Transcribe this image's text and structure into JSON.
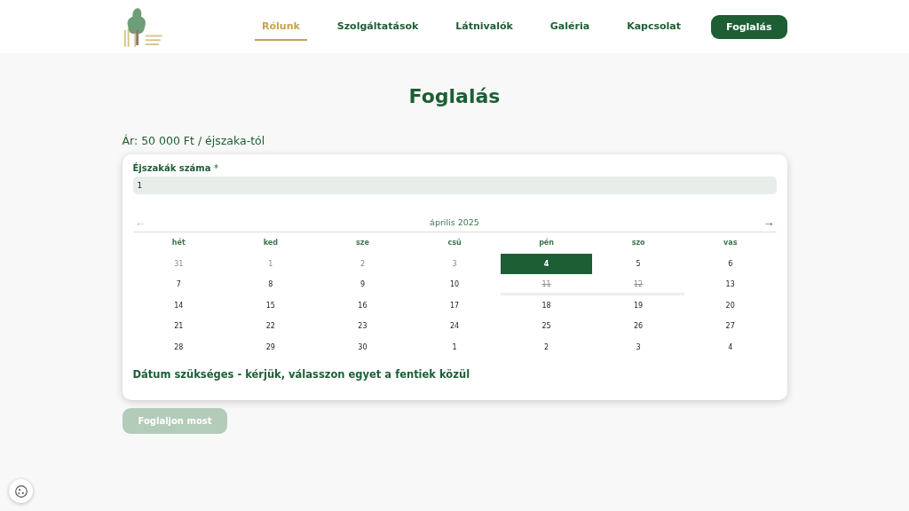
{
  "nav": {
    "items": [
      {
        "label": "Rólunk",
        "selected": true
      },
      {
        "label": "Szolgáltatások",
        "selected": false
      },
      {
        "label": "Látnivalók",
        "selected": false
      },
      {
        "label": "Galéria",
        "selected": false
      },
      {
        "label": "Kapcsolat",
        "selected": false
      }
    ],
    "cta": "Foglalás"
  },
  "heading": "Foglalás",
  "price": "Ár: 50 000 Ft / éjszaka-tól",
  "form": {
    "nights_label": "Éjszakák száma",
    "required_mark": "*",
    "nights_value": "1",
    "calendar": {
      "prev": "←",
      "month": "április 2025",
      "next": "→",
      "weekdays": [
        "hét",
        "ked",
        "sze",
        "csü",
        "pén",
        "szo",
        "vas"
      ],
      "weeks": [
        [
          {
            "day": "31",
            "disabled": true,
            "booked": false,
            "selected": false
          },
          {
            "day": "1",
            "disabled": true,
            "booked": false,
            "selected": false
          },
          {
            "day": "2",
            "disabled": true,
            "booked": false,
            "selected": false
          },
          {
            "day": "3",
            "disabled": true,
            "booked": false,
            "selected": false
          },
          {
            "day": "4",
            "disabled": false,
            "booked": false,
            "selected": true
          },
          {
            "day": "5",
            "disabled": false,
            "booked": false,
            "selected": false
          },
          {
            "day": "6",
            "disabled": false,
            "booked": false,
            "selected": false
          }
        ],
        [
          {
            "day": "7",
            "disabled": false,
            "booked": false,
            "selected": false
          },
          {
            "day": "8",
            "disabled": false,
            "booked": false,
            "selected": false
          },
          {
            "day": "9",
            "disabled": false,
            "booked": false,
            "selected": false
          },
          {
            "day": "10",
            "disabled": false,
            "booked": false,
            "selected": false
          },
          {
            "day": "11",
            "disabled": true,
            "booked": true,
            "selected": false
          },
          {
            "day": "12",
            "disabled": true,
            "booked": true,
            "selected": false
          },
          {
            "day": "13",
            "disabled": false,
            "booked": false,
            "selected": false
          }
        ],
        [
          {
            "day": "14",
            "disabled": false,
            "booked": false,
            "selected": false
          },
          {
            "day": "15",
            "disabled": false,
            "booked": false,
            "selected": false
          },
          {
            "day": "16",
            "disabled": false,
            "booked": false,
            "selected": false
          },
          {
            "day": "17",
            "disabled": false,
            "booked": false,
            "selected": false
          },
          {
            "day": "18",
            "disabled": false,
            "booked": false,
            "selected": false
          },
          {
            "day": "19",
            "disabled": false,
            "booked": false,
            "selected": false
          },
          {
            "day": "20",
            "disabled": false,
            "booked": false,
            "selected": false
          }
        ],
        [
          {
            "day": "21",
            "disabled": false,
            "booked": false,
            "selected": false
          },
          {
            "day": "22",
            "disabled": false,
            "booked": false,
            "selected": false
          },
          {
            "day": "23",
            "disabled": false,
            "booked": false,
            "selected": false
          },
          {
            "day": "24",
            "disabled": false,
            "booked": false,
            "selected": false
          },
          {
            "day": "25",
            "disabled": false,
            "booked": false,
            "selected": false
          },
          {
            "day": "26",
            "disabled": false,
            "booked": false,
            "selected": false
          },
          {
            "day": "27",
            "disabled": false,
            "booked": false,
            "selected": false
          }
        ],
        [
          {
            "day": "28",
            "disabled": false,
            "booked": false,
            "selected": false
          },
          {
            "day": "29",
            "disabled": false,
            "booked": false,
            "selected": false
          },
          {
            "day": "30",
            "disabled": false,
            "booked": false,
            "selected": false
          },
          {
            "day": "1",
            "disabled": false,
            "booked": false,
            "selected": false
          },
          {
            "day": "2",
            "disabled": false,
            "booked": false,
            "selected": false
          },
          {
            "day": "3",
            "disabled": false,
            "booked": false,
            "selected": false
          },
          {
            "day": "4",
            "disabled": false,
            "booked": false,
            "selected": false
          }
        ]
      ]
    },
    "message": "Dátum szükséges - kérjük, válasszon egyet a fentiek közül"
  },
  "submit": {
    "label": "Foglaljon most",
    "disabled": true
  }
}
